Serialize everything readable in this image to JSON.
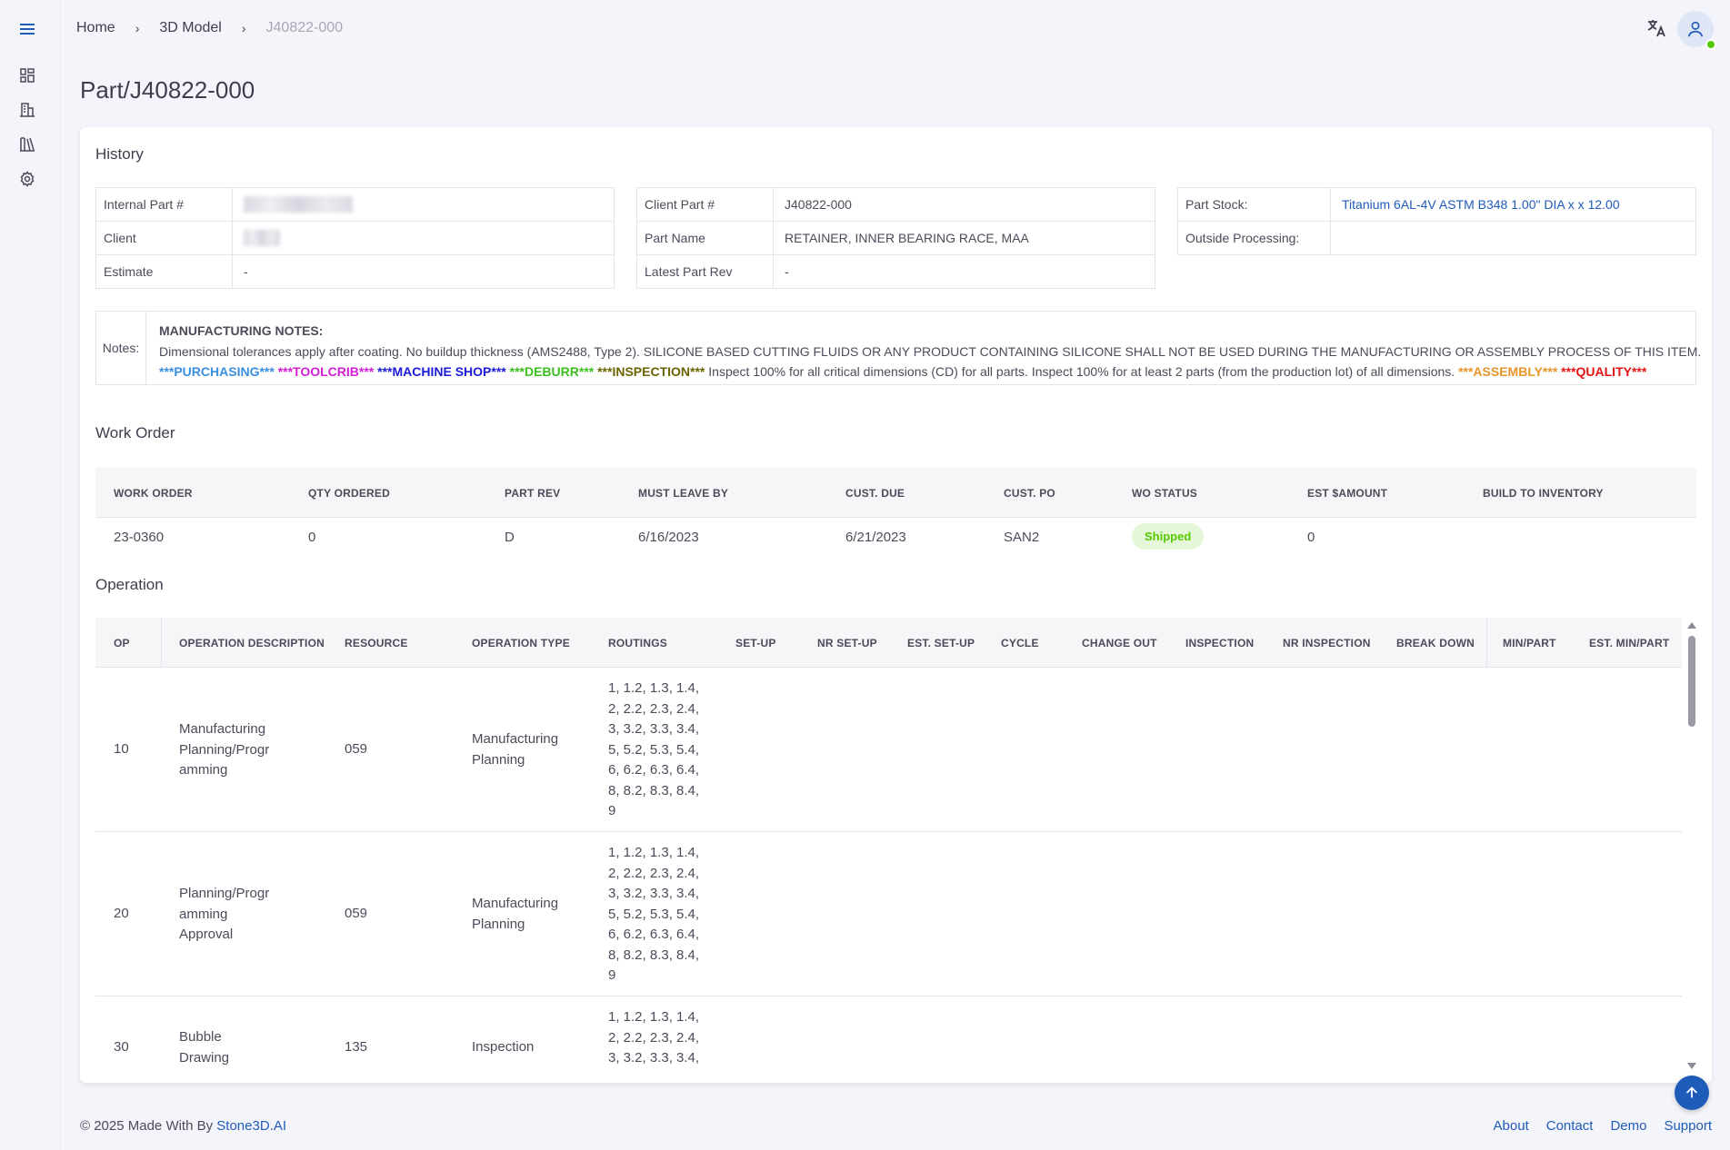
{
  "breadcrumb": {
    "home": "Home",
    "section": "3D Model",
    "current": "J40822-000"
  },
  "page_title": "Part/J40822-000",
  "history": {
    "title": "History",
    "left": [
      {
        "label": "Internal Part #",
        "value": ""
      },
      {
        "label": "Client",
        "value": ""
      },
      {
        "label": "Estimate",
        "value": "-"
      }
    ],
    "middle": [
      {
        "label": "Client Part #",
        "value": "J40822-000"
      },
      {
        "label": "Part Name",
        "value": "RETAINER, INNER BEARING RACE, MAA"
      },
      {
        "label": "Latest Part Rev",
        "value": "-"
      }
    ],
    "right": [
      {
        "label": "Part Stock:",
        "value": "Titanium 6AL-4V ASTM B348 1.00\" DIA x x 12.00"
      },
      {
        "label": "Outside Processing:",
        "value": ""
      }
    ]
  },
  "notes": {
    "label": "Notes:",
    "header": "MANUFACTURING NOTES:",
    "line1": "Dimensional tolerances apply after coating. No buildup thickness (AMS2488, Type 2). SILICONE BASED CUTTING FLUIDS OR ANY PRODUCT CONTAINING SILICONE SHALL NOT BE USED DURING THE MANUFACTURING OR ASSEMBLY PROCESS OF THIS ITEM.",
    "tags": {
      "purchasing": "***PURCHASING***",
      "toolcrib": "***TOOLCRIB***",
      "machine_shop": "***MACHINE SHOP***",
      "deburr": "***DEBURR***",
      "inspection": "***INSPECTION***",
      "assembly": "***ASSEMBLY***",
      "quality": "***QUALITY***"
    },
    "inspection_text": "Inspect 100% for all critical dimensions (CD) for all parts. Inspect 100% for at least 2 parts (from the production lot) of all dimensions.",
    "colors": {
      "purchasing": "#3b8fe0",
      "toolcrib": "#d31ed6",
      "machine_shop": "#1a1ad8",
      "deburr": "#3cbf1f",
      "inspection": "#6b6300",
      "assembly": "#e8952a",
      "quality": "#e31414"
    }
  },
  "work_order": {
    "title": "Work Order",
    "columns": [
      "WORK ORDER",
      "QTY ORDERED",
      "PART REV",
      "MUST LEAVE BY",
      "CUST. DUE",
      "CUST. PO",
      "WO STATUS",
      "EST $AMOUNT",
      "BUILD TO INVENTORY"
    ],
    "row": {
      "work_order": "23-0360",
      "qty": "0",
      "rev": "D",
      "must_leave": "6/16/2023",
      "cust_due": "6/21/2023",
      "cust_po": "SAN2",
      "status": "Shipped",
      "amount": "0",
      "build": ""
    }
  },
  "operation": {
    "title": "Operation",
    "columns": [
      "OP",
      "OPERATION DESCRIPTION",
      "RESOURCE",
      "OPERATION TYPE",
      "ROUTINGS",
      "SET-UP",
      "NR SET-UP",
      "EST. SET-UP",
      "CYCLE",
      "CHANGE OUT",
      "INSPECTION",
      "NR INSPECTION",
      "BREAK DOWN",
      "MIN/PART",
      "EST. MIN/PART"
    ],
    "rows": [
      {
        "op": "10",
        "desc": [
          "Manufacturing",
          "Planning/Progr",
          "amming"
        ],
        "resource": "059",
        "type": [
          "Manufacturing",
          "Planning"
        ],
        "routings": [
          "1, 1.2, 1.3, 1.4,",
          "2, 2.2, 2.3, 2.4,",
          "3, 3.2, 3.3, 3.4,",
          "5, 5.2, 5.3, 5.4,",
          "6, 6.2, 6.3, 6.4,",
          "8, 8.2, 8.3, 8.4,",
          "9"
        ]
      },
      {
        "op": "20",
        "desc": [
          "Planning/Progr",
          "amming",
          "Approval"
        ],
        "resource": "059",
        "type": [
          "Manufacturing",
          "Planning"
        ],
        "routings": [
          "1, 1.2, 1.3, 1.4,",
          "2, 2.2, 2.3, 2.4,",
          "3, 3.2, 3.3, 3.4,",
          "5, 5.2, 5.3, 5.4,",
          "6, 6.2, 6.3, 6.4,",
          "8, 8.2, 8.3, 8.4,",
          "9"
        ]
      },
      {
        "op": "30",
        "desc": [
          "Bubble",
          "Drawing"
        ],
        "resource": "135",
        "type": [
          "Inspection"
        ],
        "routings": [
          "1, 1.2, 1.3, 1.4,",
          "2, 2.2, 2.3, 2.4,",
          "3, 3.2, 3.3, 3.4,"
        ]
      }
    ]
  },
  "footer": {
    "copyright": "© 2025 Made With By ",
    "brand": "Stone3D.AI",
    "links": [
      "About",
      "Contact",
      "Demo",
      "Support"
    ]
  },
  "colors": {
    "accent": "#1f5bb8",
    "success": "#56ca00"
  }
}
